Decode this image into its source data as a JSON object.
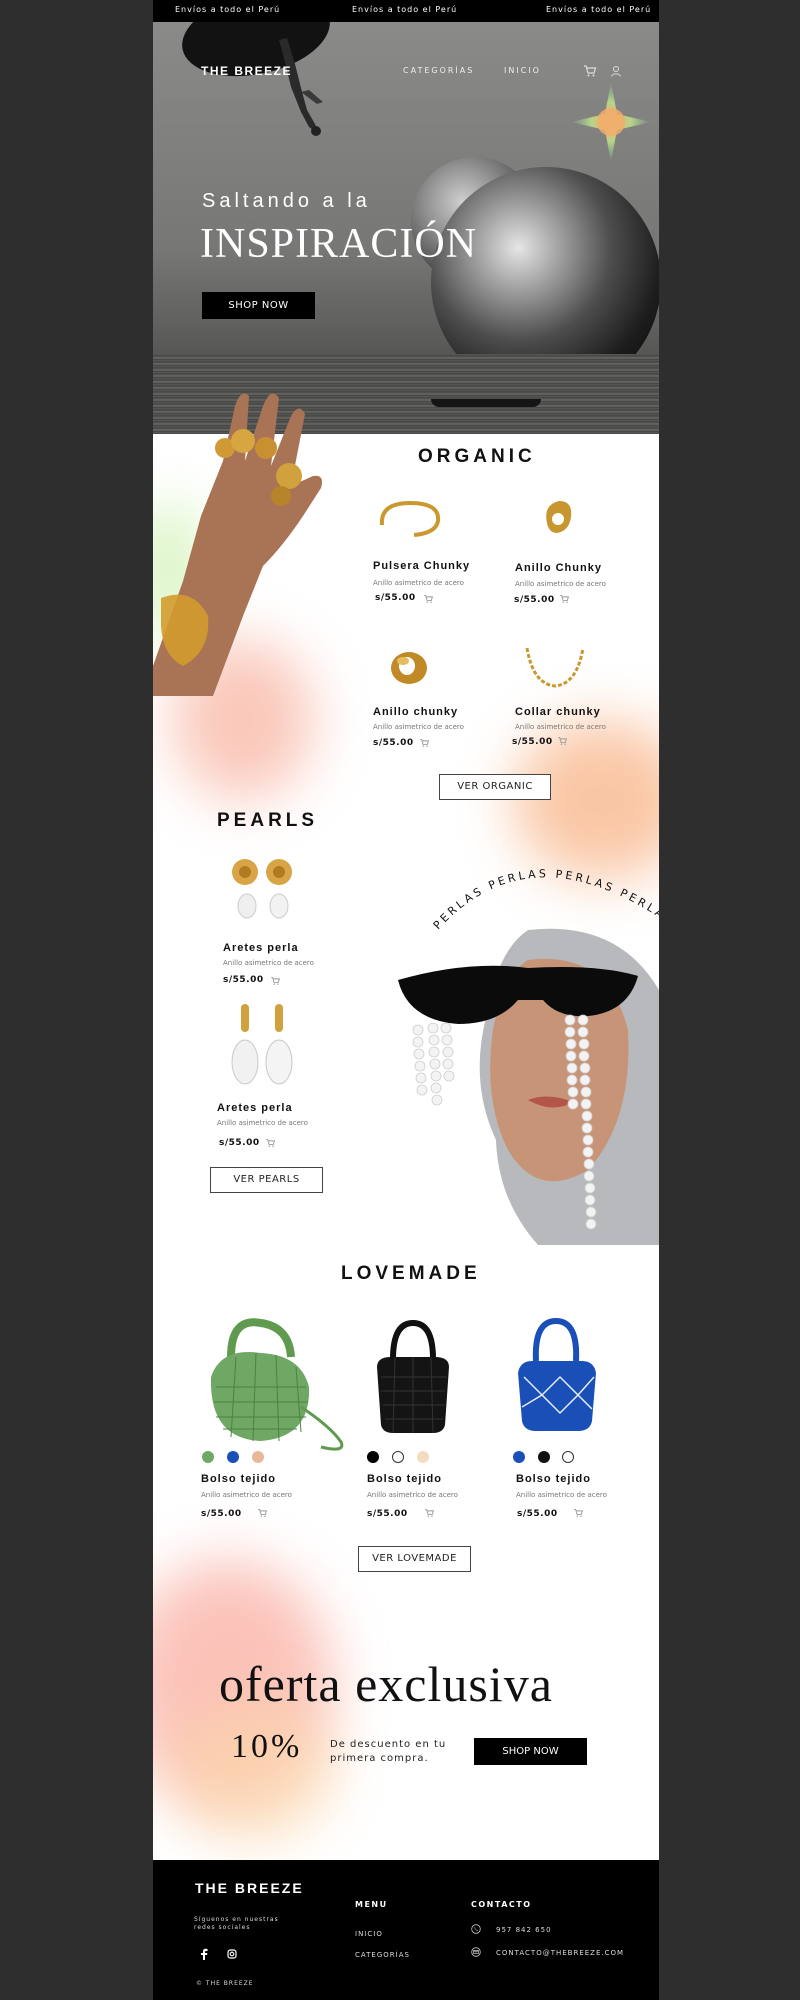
{
  "announcement": [
    "Envíos a todo el Perú",
    "Envíos a todo el Perú",
    "Envíos a todo el Perú"
  ],
  "header": {
    "logo": "THE BREEZE",
    "nav": [
      "CATEGORÍAS",
      "INICIO"
    ],
    "icons": [
      "cart-icon",
      "user-icon"
    ]
  },
  "hero": {
    "subtitle": "Saltando a la",
    "title": "INSPIRACIÓN",
    "button": "SHOP NOW"
  },
  "organic": {
    "title": "ORGANIC",
    "products": [
      {
        "name": "Pulsera Chunky",
        "desc": "Anillo asimetrico de acero",
        "price": "s/55.00"
      },
      {
        "name": "Anillo Chunky",
        "desc": "Anillo asimetrico de acero",
        "price": "s/55.00"
      },
      {
        "name": "Anillo chunky",
        "desc": "Anillo asimetrico de acero",
        "price": "s/55.00"
      },
      {
        "name": "Collar chunky",
        "desc": "Anillo asimetrico de acero",
        "price": "s/55.00"
      }
    ],
    "button": "VER ORGANIC"
  },
  "pearls": {
    "title": "PEARLS",
    "arc_text": "PERLAS PERLAS PERLAS PERLAS",
    "products": [
      {
        "name": "Aretes perla",
        "desc": "Anillo asimetrico de acero",
        "price": "s/55.00"
      },
      {
        "name": "Aretes perla",
        "desc": "Anillo asimetrico de acero",
        "price": "s/55.00"
      }
    ],
    "button": "VER PEARLS"
  },
  "lovemade": {
    "title": "LOVEMADE",
    "products": [
      {
        "name": "Bolso tejido",
        "desc": "Anillo asimetrico de acero",
        "price": "s/55.00",
        "colors": [
          "#6ea864",
          "#1a4fb8",
          "#e8b89a"
        ]
      },
      {
        "name": "Bolso tejido",
        "desc": "Anillo asimetrico de acero",
        "price": "s/55.00",
        "colors": [
          "#000000",
          "#ffffff",
          "#f3dcc0"
        ]
      },
      {
        "name": "Bolso tejido",
        "desc": "Anillo asimetrico de acero",
        "price": "s/55.00",
        "colors": [
          "#1a4fb8",
          "#111111",
          "#ffffff"
        ]
      }
    ],
    "button": "VER LOVEMADE"
  },
  "offer": {
    "title": "oferta exclusiva",
    "percent": "10%",
    "text_line1": "De descuento en tu",
    "text_line2": "primera compra.",
    "button": "SHOP NOW"
  },
  "footer": {
    "logo": "THE BREEZE",
    "social_line1": "Síguenos en nuestras",
    "social_line2": "redes sociales",
    "copyright": "© THE BREEZE",
    "menu_title": "MENU",
    "menu": [
      "INICIO",
      "CATEGORÍAS"
    ],
    "contact_title": "CONTACTO",
    "phone": "957 842 650",
    "email": "CONTACTO@THEBREEZE.COM"
  },
  "colors": {
    "accent": "#000000",
    "page_bg": "#2e2e2e"
  }
}
